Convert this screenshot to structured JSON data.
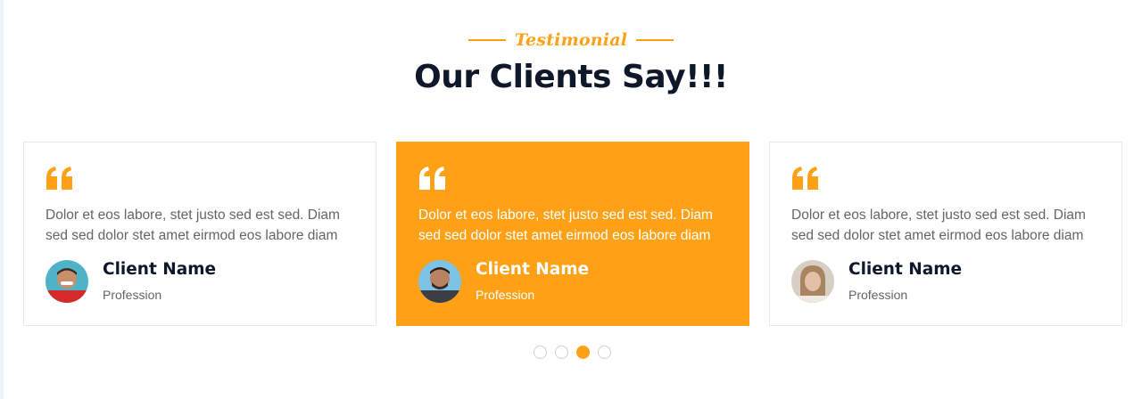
{
  "section": {
    "tag": "Testimonial",
    "title": "Our Clients Say!!!"
  },
  "colors": {
    "accent": "#fea116",
    "heading": "#0f172b",
    "body_text": "#666565"
  },
  "testimonials": [
    {
      "text": "Dolor et eos labore, stet justo sed est sed. Diam sed sed dolor stet amet eirmod eos labore diam",
      "name": "Client Name",
      "profession": "Profession",
      "active": false
    },
    {
      "text": "Dolor et eos labore, stet justo sed est sed. Diam sed sed dolor stet amet eirmod eos labore diam",
      "name": "Client Name",
      "profession": "Profession",
      "active": true
    },
    {
      "text": "Dolor et eos labore, stet justo sed est sed. Diam sed sed dolor stet amet eirmod eos labore diam",
      "name": "Client Name",
      "profession": "Profession",
      "active": false
    }
  ],
  "carousel": {
    "dot_count": 4,
    "active_dot": 3
  },
  "icons": {
    "quote": "quote-left-icon"
  }
}
